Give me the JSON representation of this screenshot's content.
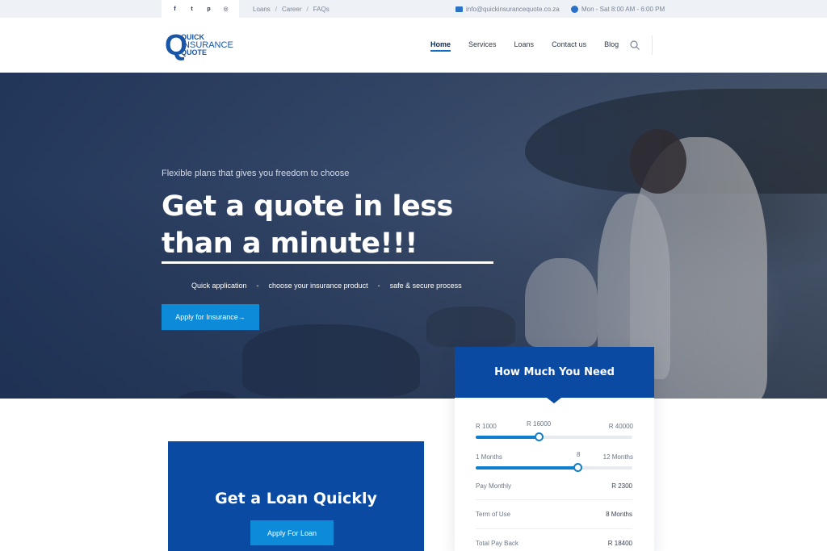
{
  "topbar": {
    "social": [
      {
        "icon": "facebook-icon",
        "glyph": "f"
      },
      {
        "icon": "twitter-icon",
        "glyph": "t"
      },
      {
        "icon": "pinterest-icon",
        "glyph": "p"
      },
      {
        "icon": "instagram-icon",
        "glyph": "◎"
      }
    ],
    "links": [
      "Loans",
      "Career",
      "FAQs"
    ],
    "separator": "/",
    "email": "info@quickinsurancequote.co.za",
    "hours": "Mon - Sat 8:00 AM - 6:00 PM"
  },
  "logo": {
    "letter": "Q",
    "line1": "QUICK",
    "line2": "INSURANCE",
    "line3": "QUOTE"
  },
  "nav": {
    "items": [
      "Home",
      "Services",
      "Loans",
      "Contact us",
      "Blog"
    ],
    "active": "Home",
    "search_icon": "search-icon"
  },
  "hero": {
    "subtitle": "Flexible plans that gives you freedom to choose",
    "title_line1": "Get a quote in less",
    "title_line2": "than a minute!!!",
    "features": [
      "Quick application",
      "choose your insurance product",
      "safe & secure process"
    ],
    "feature_separator": "-",
    "cta": "Apply for Insurance→"
  },
  "calculator": {
    "title": "How Much You Need",
    "amount": {
      "min": "R 1000",
      "value": "R 16000",
      "max": "R 40000",
      "fraction": 0.4
    },
    "term": {
      "min": "1 Months",
      "value": "8",
      "max": "12 Months",
      "fraction": 0.65
    },
    "rows": [
      {
        "label": "Pay Monthly",
        "value": "R 2300"
      },
      {
        "label": "Term of Use",
        "value": "8 Months"
      },
      {
        "label": "Total Pay Back",
        "value": "R 18400"
      }
    ]
  },
  "loan": {
    "title": "Get a Loan Quickly",
    "button": "Apply For Loan"
  },
  "colors": {
    "brand": "#0b4aa2",
    "accent": "#0d8ad8",
    "topbar_bg": "#eef1f6"
  }
}
